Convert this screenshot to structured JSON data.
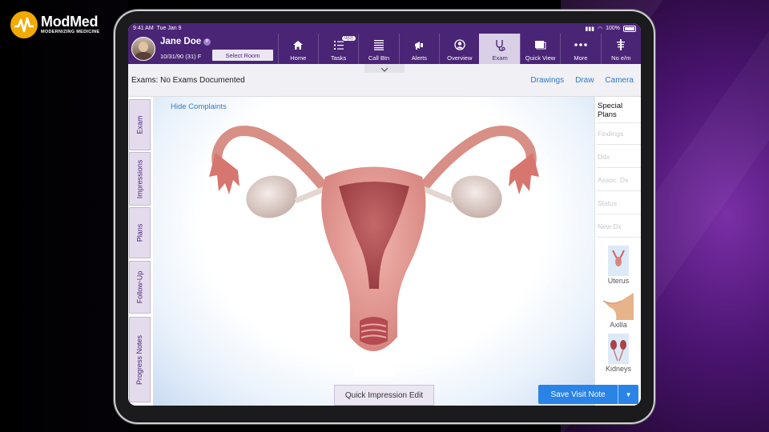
{
  "brand": {
    "name": "ModMed",
    "tagline": "MODERNIZING MEDICINE"
  },
  "status_bar": {
    "time": "9:41 AM",
    "date": "Tue Jan 9",
    "battery": "100%"
  },
  "patient": {
    "name": "Jane Doe",
    "badge": "P",
    "dob": "10/31/90 (31) F",
    "select_room": "Select Room"
  },
  "nav": [
    {
      "label": "Home",
      "icon": "home-icon"
    },
    {
      "label": "Tasks",
      "icon": "tasks-icon",
      "badge": "0(0)"
    },
    {
      "label": "Call Btn",
      "icon": "call-button-icon"
    },
    {
      "label": "Alerts",
      "icon": "megaphone-icon"
    },
    {
      "label": "Overview",
      "icon": "person-circle-icon"
    },
    {
      "label": "Exam",
      "icon": "stethoscope-icon",
      "active": true
    },
    {
      "label": "Quick View",
      "icon": "quick-view-icon"
    },
    {
      "label": "More",
      "icon": "more-dots-icon"
    },
    {
      "label": "No e/m",
      "icon": "em-icon"
    }
  ],
  "toolbar": {
    "exams_label": "Exams: No Exams Documented",
    "drawings": "Drawings",
    "draw": "Draw",
    "camera": "Camera"
  },
  "left_tabs": [
    "Exam",
    "Impressions",
    "Plans",
    "Follow-Up",
    "Progress Notes"
  ],
  "canvas": {
    "hide_complaints": "Hide Complaints"
  },
  "right_panel": {
    "special_plans": "Special Plans",
    "buttons": [
      "Findings",
      "Ddx",
      "Assoc. Dx",
      "Status",
      "New Dx"
    ],
    "thumbnails": [
      "Uterus",
      "Axilla",
      "Kidneys"
    ]
  },
  "footer": {
    "quick_impression_edit": "Quick Impression Edit",
    "save_visit_note": "Save Visit Note"
  },
  "colors": {
    "nav_bg": "#4a2576",
    "accent": "#2a83e6",
    "link": "#2f78c4"
  }
}
